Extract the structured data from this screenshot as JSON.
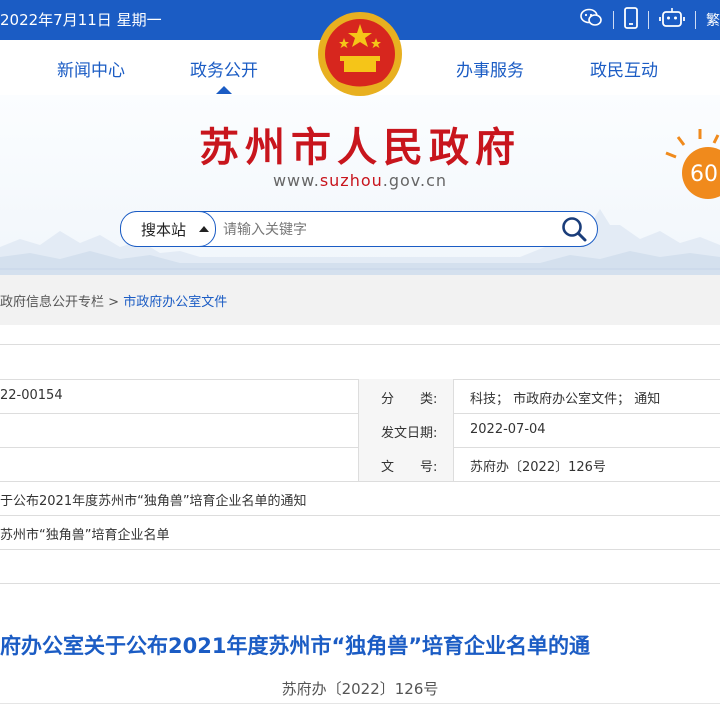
{
  "topbar": {
    "date": "2022年7月11日 星期一",
    "tools": [
      {
        "icon": "wechat-icon"
      },
      {
        "icon": "mobile-icon"
      },
      {
        "icon": "robot-icon"
      }
    ],
    "traditional": "繁"
  },
  "nav": {
    "items": [
      "新闻中心",
      "政务公开",
      "办事服务",
      "政民互动"
    ],
    "active": "政务公开"
  },
  "site": {
    "title": "苏州市人民政府",
    "url_prefix": "www.",
    "url_highlight": "suzhou",
    "url_suffix": ".gov.cn",
    "badge_text": "60"
  },
  "search": {
    "scope_label": "搜本站",
    "placeholder": "请输入关键字"
  },
  "breadcrumb": {
    "parent": "政府信息公开专栏",
    "separator": ">",
    "current": "市政府办公室文件"
  },
  "meta": {
    "rows": [
      {
        "value": "22-00154",
        "label": "分　　类:",
        "label_value": "科技； 市政府办公室文件； 通知"
      },
      {
        "value": "",
        "label": "发文日期:",
        "label_value": "2022-07-04"
      },
      {
        "value": "",
        "label": "文　　号:",
        "label_value": "苏府办〔2022〕126号"
      },
      {
        "value": "于公布2021年度苏州市“独角兽”培育企业名单的通知"
      },
      {
        "value": "苏州市“独角兽”培育企业名单"
      },
      {
        "value": ""
      }
    ]
  },
  "document": {
    "title": "府办公室关于公布2021年度苏州市“独角兽”培育企业名单的通",
    "number": "苏府办〔2022〕126号"
  },
  "colors": {
    "primary": "#1b5cc4",
    "title_red": "#c8151d",
    "badge_orange": "#f08a1c"
  }
}
